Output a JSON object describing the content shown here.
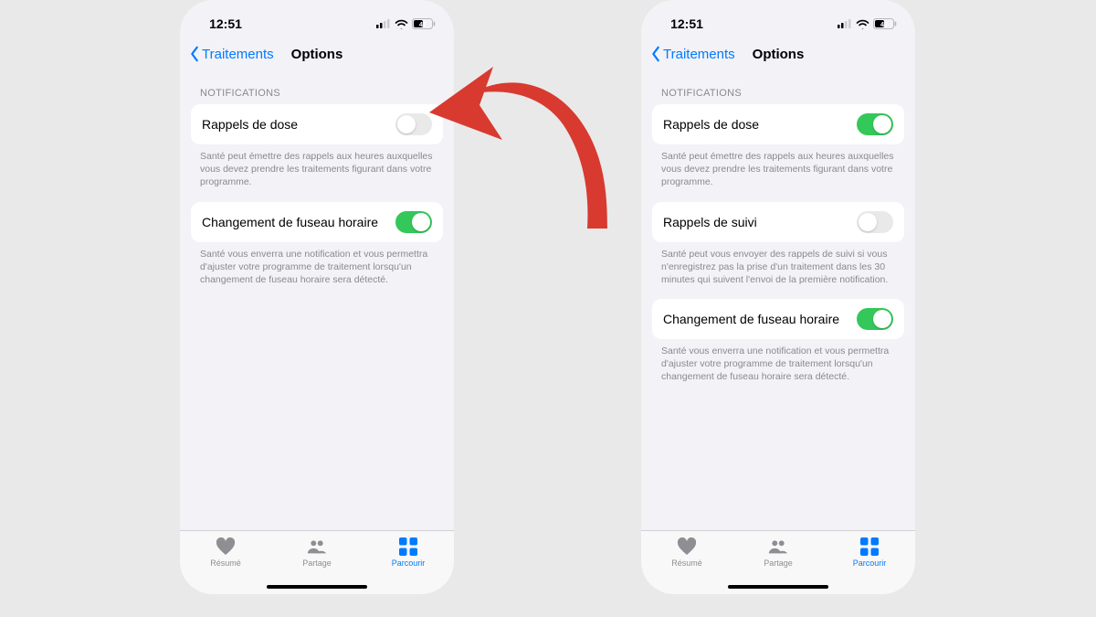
{
  "status": {
    "time": "12:51",
    "battery": "47"
  },
  "nav": {
    "back": "Traitements",
    "title": "Options"
  },
  "section_notifications": "Notifications",
  "rows": {
    "dose": {
      "label": "Rappels de dose",
      "footer": "Santé peut émettre des rappels aux heures auxquelles vous devez prendre les traitements figurant dans votre programme."
    },
    "suivi": {
      "label": "Rappels de suivi",
      "footer": "Santé peut vous envoyer des rappels de suivi si vous n'enregistrez pas la prise d'un traitement dans les 30 minutes qui suivent l'envoi de la première notification."
    },
    "fuseau": {
      "label": "Changement de fuseau horaire",
      "footer": "Santé vous enverra une notification et vous permettra d'ajuster votre programme de traitement lorsqu'un changement de fuseau horaire sera détecté."
    }
  },
  "tabs": {
    "resume": "Résumé",
    "partage": "Partage",
    "parcourir": "Parcourir"
  },
  "screens": {
    "left": {
      "dose_on": false,
      "show_suivi": false,
      "fuseau_on": true
    },
    "right": {
      "dose_on": true,
      "show_suivi": true,
      "suivi_on": false,
      "fuseau_on": true
    }
  },
  "arrow_color": "#d83a2f"
}
